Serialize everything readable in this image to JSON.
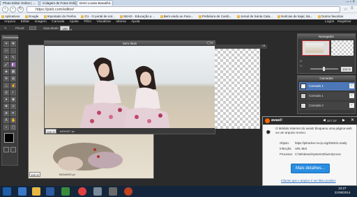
{
  "browser": {
    "tabs": [
      {
        "label": "Photo Editor Online | ..."
      },
      {
        "label": "Colagem de Fotos Online"
      },
      {
        "label": "Demi Lovato Beautiful..."
      }
    ],
    "url": "https://pixlr.com/editor/",
    "bookmarks": [
      "Aplicativos",
      "Google",
      "Importado do Firefox",
      "G1 - O portal de not...",
      "NEAD - Educação a ...",
      "Bem-vindo ao Face...",
      "Prefeitura de Camb...",
      "Jornal de Santa Cata...",
      "Notícias de Itajaí, Ba...",
      "Outros favoritos"
    ]
  },
  "editor": {
    "menu": [
      "Arquivo",
      "Editar",
      "Imagem",
      "Camada",
      "Ajuste",
      "Filtro",
      "Visualizar",
      "Idioma",
      "Ajuda"
    ],
    "user_links": [
      "Logon",
      "Registrar"
    ],
    "options": {
      "label_a": "Pincel:",
      "label_b": "Opacidade:",
      "opacity_value": "100"
    },
    "tools_title": "Ferramentas",
    "document_title": "Sem título",
    "document_zoom": "100 %",
    "document_size": "640x3X7 px",
    "background_zoom": "100 %",
    "background_size": "640x6200 px",
    "navigator": {
      "title": "Navegador",
      "x_label": "X:",
      "y_label": "Y:",
      "zoom": "100 %"
    },
    "layers": {
      "title": "Camadas",
      "items": [
        {
          "label": "Camada 1",
          "selected": true
        },
        {
          "label": "Camada 1",
          "selected": false
        },
        {
          "label": "Camada 0",
          "selected": false
        }
      ]
    }
  },
  "avast": {
    "brand": "avast!",
    "pager": "17 / 17",
    "message": "O Módulo Internet do avast! bloqueou uma página web ou um arquivo nocivo.",
    "objeto_label": "Objeto:",
    "objeto_value": "https://pitracker.no-ip.org/8181/is-ready",
    "infeccao_label": "Infecção:",
    "infeccao_value": "URL:Mal",
    "processo_label": "Processo:",
    "processo_value": "C:\\Windows\\System32\\wscript.exe",
    "button": "Mais detalhes...",
    "link": "Informe que o arquivo é um falso positivo"
  },
  "taskbar": {
    "time": "23:27",
    "date": "21/08/2014"
  }
}
